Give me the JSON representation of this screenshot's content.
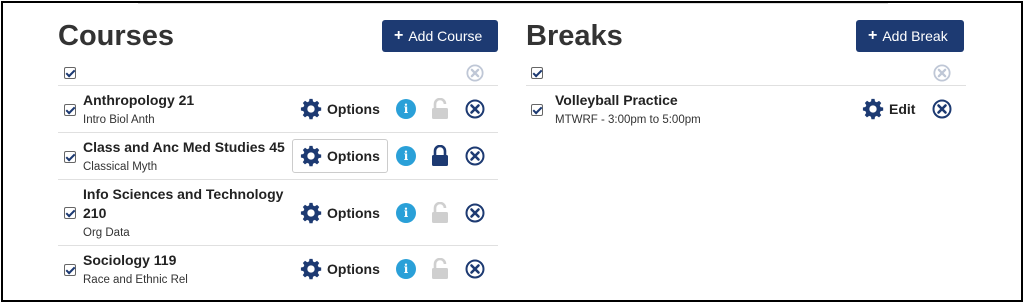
{
  "courses": {
    "title": "Courses",
    "add_label": "Add Course",
    "items": [
      {
        "name": "Anthropology 21",
        "sub": "Intro Biol Anth",
        "options_label": "Options",
        "locked": false
      },
      {
        "name": "Class and Anc Med Studies 45",
        "sub": "Classical Myth",
        "options_label": "Options",
        "locked": true
      },
      {
        "name_line1": "Info Sciences and Technology",
        "name_line2": "210",
        "sub": "Org Data",
        "options_label": "Options",
        "locked": false
      },
      {
        "name": "Sociology 119",
        "sub": "Race and Ethnic Rel",
        "options_label": "Options",
        "locked": false
      }
    ]
  },
  "breaks": {
    "title": "Breaks",
    "add_label": "Add Break",
    "items": [
      {
        "name": "Volleyball Practice",
        "sub": "MTWRF - 3:00pm to 5:00pm",
        "edit_label": "Edit"
      }
    ]
  },
  "colors": {
    "accent": "#1d3a72",
    "info": "#2aa0d8",
    "lock_inactive": "#cfcfcf"
  }
}
